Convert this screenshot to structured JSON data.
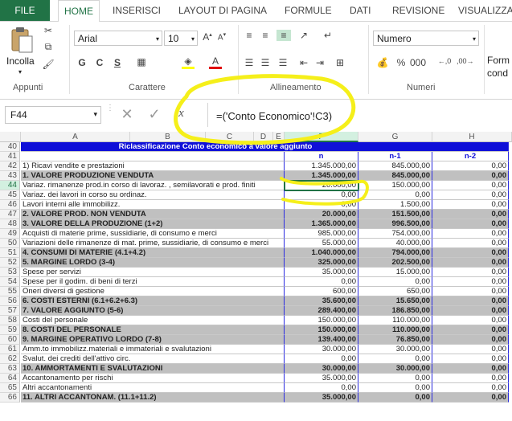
{
  "ribbon_tabs": [
    "FILE",
    "HOME",
    "INSERISCI",
    "LAYOUT DI PAGINA",
    "FORMULE",
    "DATI",
    "REVISIONE",
    "VISUALIZZA"
  ],
  "clipboard": {
    "paste_label": "Incolla",
    "group_label": "Appunti"
  },
  "font": {
    "name": "Arial",
    "size": "10",
    "bold": "G",
    "italic": "C",
    "underline": "S",
    "group_label": "Carattere"
  },
  "alignment": {
    "group_label": "Allineamento"
  },
  "number": {
    "format": "Numero",
    "group_label": "Numeri"
  },
  "format_cond": {
    "label1": "Form",
    "label2": "cond"
  },
  "formula_bar": {
    "name_box": "F44",
    "fx": "fx",
    "formula": "=('Conto Economico'!C3)"
  },
  "columns": [
    "A",
    "B",
    "C",
    "D",
    "E",
    "F",
    "G",
    "H"
  ],
  "sheet": {
    "title": "Riclassificazione Conto economico a valore aggiunto",
    "col_headers": {
      "n": "n",
      "n1": "n-1",
      "n2": "n-2"
    },
    "rows": [
      {
        "num": "42",
        "label": "1) Ricavi vendite e prestazioni",
        "n": "1.345.000,00",
        "n1": "845.000,00",
        "n2": "0,00",
        "style": "normal"
      },
      {
        "num": "43",
        "label": "1. VALORE PRODUZIONE VENDUTA",
        "n": "1.345.000,00",
        "n1": "845.000,00",
        "n2": "0,00",
        "style": "total"
      },
      {
        "num": "44",
        "label": "Variaz. rimanenze prod.in corso di lavoraz. , semilavorati e prod. finiti",
        "n": "20.000,00",
        "n1": "150.000,00",
        "n2": "0,00",
        "style": "normal"
      },
      {
        "num": "45",
        "label": "Variaz. dei lavori in corso su ordinaz.",
        "n": "0,00",
        "n1": "0,00",
        "n2": "0,00",
        "style": "normal"
      },
      {
        "num": "46",
        "label": "Lavori interni alle immobilizz.",
        "n": "0,00",
        "n1": "1.500,00",
        "n2": "0,00",
        "style": "normal"
      },
      {
        "num": "47",
        "label": "2. VALORE PROD. NON VENDUTA",
        "n": "20.000,00",
        "n1": "151.500,00",
        "n2": "0,00",
        "style": "total"
      },
      {
        "num": "48",
        "label": "3. VALORE DELLA PRODUZIONE (1+2)",
        "n": "1.365.000,00",
        "n1": "996.500,00",
        "n2": "0,00",
        "style": "total"
      },
      {
        "num": "49",
        "label": "Acquisti di materie prime, sussidiarie, di consumo e merci",
        "n": "985.000,00",
        "n1": "754.000,00",
        "n2": "0,00",
        "style": "normal"
      },
      {
        "num": "50",
        "label": "Variazioni delle rimanenze di mat. prime, sussidiarie, di consumo e merci",
        "n": "55.000,00",
        "n1": "40.000,00",
        "n2": "0,00",
        "style": "normal"
      },
      {
        "num": "51",
        "label": "4. CONSUMI DI MATERIE (4.1+4.2)",
        "n": "1.040.000,00",
        "n1": "794.000,00",
        "n2": "0,00",
        "style": "total"
      },
      {
        "num": "52",
        "label": "5. MARGINE LORDO (3-4)",
        "n": "325.000,00",
        "n1": "202.500,00",
        "n2": "0,00",
        "style": "total"
      },
      {
        "num": "53",
        "label": "Spese per servizi",
        "n": "35.000,00",
        "n1": "15.000,00",
        "n2": "0,00",
        "style": "normal"
      },
      {
        "num": "54",
        "label": "Spese per il godim. di beni di terzi",
        "n": "0,00",
        "n1": "0,00",
        "n2": "0,00",
        "style": "normal"
      },
      {
        "num": "55",
        "label": "Oneri diversi di gestione",
        "n": "600,00",
        "n1": "650,00",
        "n2": "0,00",
        "style": "normal"
      },
      {
        "num": "56",
        "label": "6. COSTI ESTERNI (6.1+6.2+6.3)",
        "n": "35.600,00",
        "n1": "15.650,00",
        "n2": "0,00",
        "style": "total"
      },
      {
        "num": "57",
        "label": "7. VALORE AGGIUNTO (5-6)",
        "n": "289.400,00",
        "n1": "186.850,00",
        "n2": "0,00",
        "style": "total"
      },
      {
        "num": "58",
        "label": "Costi del personale",
        "n": "150.000,00",
        "n1": "110.000,00",
        "n2": "0,00",
        "style": "normal"
      },
      {
        "num": "59",
        "label": "8. COSTI DEL PERSONALE",
        "n": "150.000,00",
        "n1": "110.000,00",
        "n2": "0,00",
        "style": "total"
      },
      {
        "num": "60",
        "label": "9. MARGINE OPERATIVO LORDO (7-8)",
        "n": "139.400,00",
        "n1": "76.850,00",
        "n2": "0,00",
        "style": "total"
      },
      {
        "num": "61",
        "label": "Amm.to immobilizz.materiali e immateriali e svalutazioni",
        "n": "30.000,00",
        "n1": "30.000,00",
        "n2": "0,00",
        "style": "normal"
      },
      {
        "num": "62",
        "label": "Svalut. dei crediti dell'attivo circ.",
        "n": "0,00",
        "n1": "0,00",
        "n2": "0,00",
        "style": "normal"
      },
      {
        "num": "63",
        "label": "10. AMMORTAMENTI E SVALUTAZIONI",
        "n": "30.000,00",
        "n1": "30.000,00",
        "n2": "0,00",
        "style": "total"
      },
      {
        "num": "64",
        "label": "Accantonamento per rischi",
        "n": "35.000,00",
        "n1": "0,00",
        "n2": "0,00",
        "style": "normal"
      },
      {
        "num": "65",
        "label": "Altri accantonamenti",
        "n": "0,00",
        "n1": "0,00",
        "n2": "0,00",
        "style": "normal"
      },
      {
        "num": "66",
        "label": "11. ALTRI ACCANTONAM. (11.1+11.2)",
        "n": "35.000,00",
        "n1": "0,00",
        "n2": "0,00",
        "style": "total"
      }
    ]
  },
  "colors": {
    "excel_green": "#217346",
    "header_blue": "#1010d8",
    "total_gray": "#c0c0c0",
    "annotation": "#f5ef1a"
  }
}
